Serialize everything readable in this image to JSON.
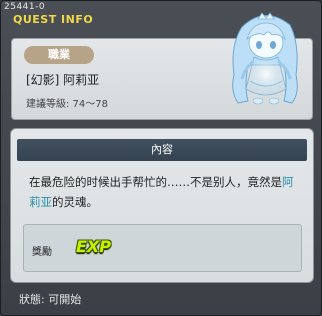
{
  "quest_id": "25441-0",
  "title": "QUEST INFO",
  "job": {
    "tag": "職業",
    "name": "[幻影] 阿莉亚",
    "level": "建議等級: 74～78"
  },
  "content": {
    "header": "內容",
    "text_before": "在最危险的时候出手帮忙的……不是别人，竟然是",
    "highlight": "阿莉亚",
    "text_after": "的灵魂。"
  },
  "reward": {
    "label": "獎勵",
    "icon": "EXP"
  },
  "status": "狀態: 可開始",
  "colors": {
    "title": "#f1d84a",
    "highlight": "#2a8fa7",
    "exp": "#c8f000"
  }
}
